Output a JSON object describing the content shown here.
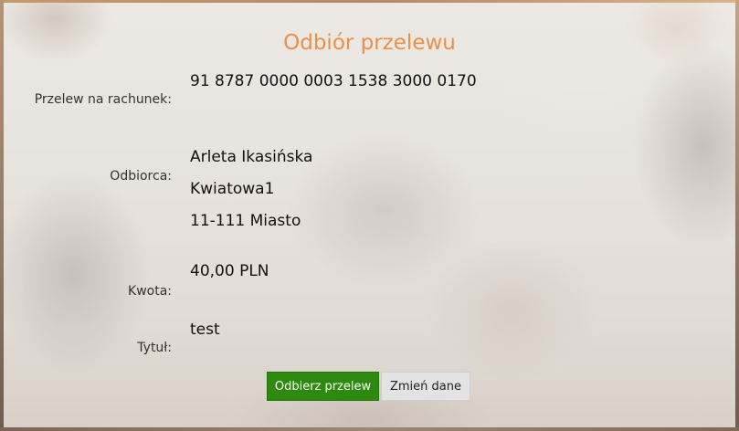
{
  "page": {
    "title": "Odbiór przelewu"
  },
  "fields": {
    "account": {
      "label": "Przelew na rachunek:",
      "value": "91 8787 0000 0003 1538 3000 0170"
    },
    "recipient": {
      "label": "Odbiorca:",
      "name": "Arleta Ikasińska",
      "street": "Kwiatowa1",
      "city": "11-111 Miasto"
    },
    "amount": {
      "label": "Kwota:",
      "value": "40,00 PLN"
    },
    "title": {
      "label": "Tytuł:",
      "value": "test"
    }
  },
  "actions": {
    "receive_label": "Odbierz przelew",
    "change_label": "Zmień dane"
  },
  "colors": {
    "title": "#e8914b",
    "primary_button": "#2d8a0f",
    "secondary_button": "#e3e3e3"
  }
}
